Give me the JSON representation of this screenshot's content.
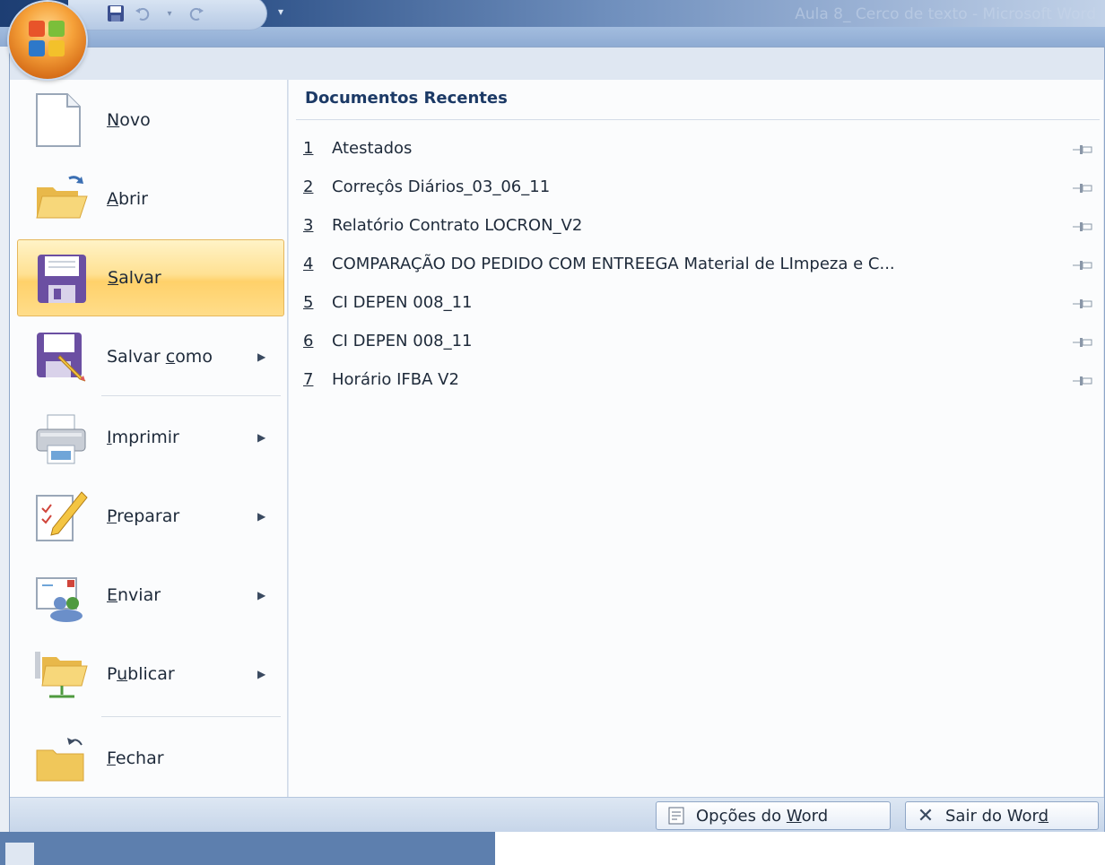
{
  "window": {
    "title": "Aula 8_ Cerco de texto - Microsoft Word"
  },
  "quick_access": {
    "save_icon": "save-icon",
    "undo_icon": "undo-icon",
    "redo_icon": "redo-icon",
    "customize_icon": "customize-arrow-icon"
  },
  "menu": {
    "items": [
      {
        "label": "Novo",
        "key": "N",
        "icon": "new-document-icon"
      },
      {
        "label": "Abrir",
        "key": "A",
        "icon": "open-folder-icon"
      },
      {
        "label": "Salvar",
        "key": "S",
        "icon": "save-icon",
        "active": true
      },
      {
        "label": "Salvar como",
        "key": "c",
        "icon": "save-as-icon",
        "submenu": true
      },
      {
        "label": "Imprimir",
        "key": "I",
        "icon": "print-icon",
        "submenu": true
      },
      {
        "label": "Preparar",
        "key": "P",
        "icon": "prepare-icon",
        "submenu": true
      },
      {
        "label": "Enviar",
        "key": "E",
        "icon": "send-icon",
        "submenu": true
      },
      {
        "label": "Publicar",
        "key": "u",
        "icon": "publish-icon",
        "submenu": true
      },
      {
        "label": "Fechar",
        "key": "F",
        "icon": "close-folder-icon"
      }
    ]
  },
  "recent": {
    "heading": "Documentos Recentes",
    "documents": [
      {
        "num": "1",
        "name": "Atestados"
      },
      {
        "num": "2",
        "name": "Correçôs Diários_03_06_11"
      },
      {
        "num": "3",
        "name": "Relatório Contrato LOCRON_V2"
      },
      {
        "num": "4",
        "name": "COMPARAÇÃO DO PEDIDO COM ENTREEGA Material de LImpeza e C..."
      },
      {
        "num": "5",
        "name": "CI DEPEN 008_11"
      },
      {
        "num": "6",
        "name": "CI DEPEN 008_11"
      },
      {
        "num": "7",
        "name": "Horário IFBA V2"
      }
    ]
  },
  "footer": {
    "options_label": "Opções do Word",
    "exit_label": "Sair do Word"
  },
  "colors": {
    "accent_orange": "#f6a23a",
    "highlight": "#ffe193",
    "heading_blue": "#1c3a66"
  }
}
